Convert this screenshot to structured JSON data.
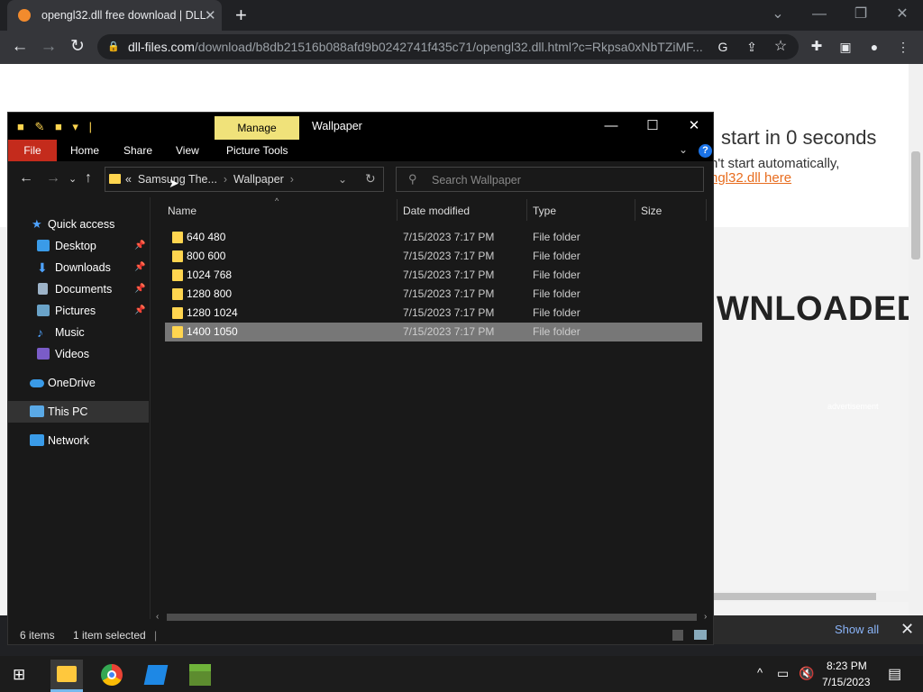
{
  "browser": {
    "tab_title": "opengl32.dll free download | DLL",
    "url_host": "dll-files.com",
    "url_path": "/download/b8db21516b088afd9b0242741f435c71/opengl32.dll.html?c=Rkpsa0xNbTZiMF..."
  },
  "webpage": {
    "start_text": "start in 0 seconds",
    "auto_text": "n't start automatically,",
    "link_text": "ngl32.dll here",
    "downloaded_text": "WNLOADED",
    "advert_text": "advertisement"
  },
  "downloads_bar": {
    "show_all": "Show all"
  },
  "explorer": {
    "manage_label": "Manage",
    "title": "Wallpaper",
    "ribbon_tabs": {
      "file": "File",
      "home": "Home",
      "share": "Share",
      "view": "View",
      "picture_tools": "Picture Tools"
    },
    "address": {
      "crumb_prefix": "«",
      "crumb1": "Samsung The...",
      "crumb2": "Wallpaper"
    },
    "search_placeholder": "Search Wallpaper",
    "nav": {
      "quick_access": "Quick access",
      "desktop": "Desktop",
      "downloads": "Downloads",
      "documents": "Documents",
      "pictures": "Pictures",
      "music": "Music",
      "videos": "Videos",
      "onedrive": "OneDrive",
      "this_pc": "This PC",
      "network": "Network"
    },
    "columns": {
      "name": "Name",
      "date": "Date modified",
      "type": "Type",
      "size": "Size"
    },
    "files": [
      {
        "name": "640 480",
        "date": "7/15/2023 7:17 PM",
        "type": "File folder"
      },
      {
        "name": "800 600",
        "date": "7/15/2023 7:17 PM",
        "type": "File folder"
      },
      {
        "name": "1024 768",
        "date": "7/15/2023 7:17 PM",
        "type": "File folder"
      },
      {
        "name": "1280 800",
        "date": "7/15/2023 7:17 PM",
        "type": "File folder"
      },
      {
        "name": "1280 1024",
        "date": "7/15/2023 7:17 PM",
        "type": "File folder"
      },
      {
        "name": "1400 1050",
        "date": "7/15/2023 7:17 PM",
        "type": "File folder"
      }
    ],
    "status": {
      "items": "6 items",
      "selected": "1 item selected"
    }
  },
  "taskbar": {
    "time": "8:23 PM",
    "date": "7/15/2023"
  }
}
